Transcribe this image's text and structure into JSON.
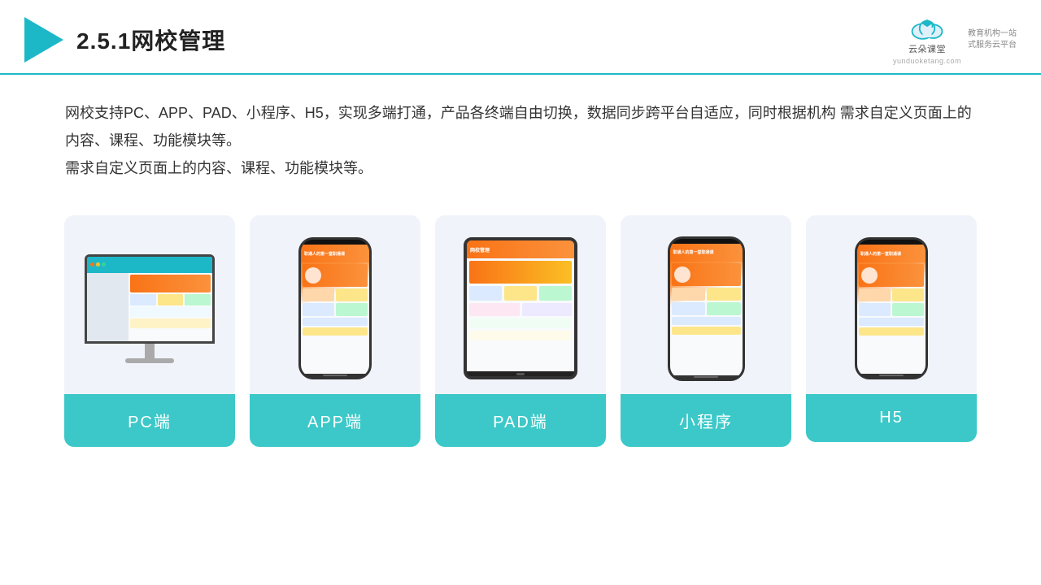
{
  "header": {
    "title": "2.5.1网校管理",
    "brand_name": "云朵课堂",
    "brand_url": "yunduoketang.com",
    "brand_tagline": "教育机构一站\n式服务云平台"
  },
  "description": "网校支持PC、APP、PAD、小程序、H5，实现多端打通，产品各终端自由切换，数据同步跨平台自适应，同时根据机构\n需求自定义页面上的内容、课程、功能模块等。",
  "cards": [
    {
      "id": "pc",
      "label": "PC端"
    },
    {
      "id": "app",
      "label": "APP端"
    },
    {
      "id": "pad",
      "label": "PAD端"
    },
    {
      "id": "miniprogram",
      "label": "小程序"
    },
    {
      "id": "h5",
      "label": "H5"
    }
  ]
}
